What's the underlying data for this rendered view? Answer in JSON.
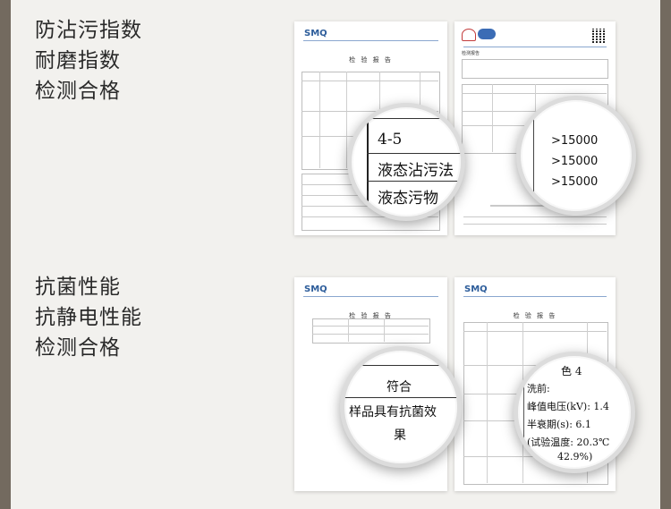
{
  "section1": {
    "lines": [
      "防沾污指数",
      "耐磨指数",
      "检测合格"
    ]
  },
  "section2": {
    "lines": [
      "抗菌性能",
      "抗静电性能",
      "检测合格"
    ]
  },
  "doc1": {
    "logo": "SMQ",
    "title": "检 验 报 告"
  },
  "doc2": {
    "title": "检测报告"
  },
  "doc3": {
    "logo": "SMQ",
    "title": "检 验 报 告"
  },
  "doc4": {
    "logo": "SMQ",
    "title": "检 验 报 告"
  },
  "mag1": {
    "lines": [
      "4-5",
      "液态沾污法",
      "液态污物"
    ]
  },
  "mag2": {
    "values": [
      ">15000",
      ">15000",
      ">15000"
    ]
  },
  "mag3": {
    "lines": [
      "符合",
      "样品具有抗菌效",
      "果"
    ]
  },
  "mag4": {
    "lines": [
      "色 4",
      "洗前:",
      "峰值电压(kV): 1.4",
      "半衰期(s): 6.1",
      "(试验温度: 20.3℃",
      "42.9%)"
    ]
  }
}
